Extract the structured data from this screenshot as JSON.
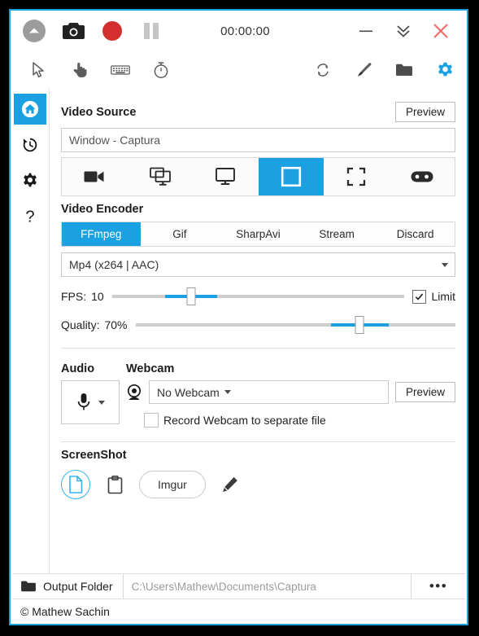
{
  "window": {
    "border_color": "#1ba1e2",
    "accent_color": "#1ba1e2"
  },
  "titlebar": {
    "timer": "00:00:00",
    "buttons": [
      {
        "name": "expand-collapse-button",
        "icon": "chevron-up-circle-icon"
      },
      {
        "name": "screenshot-button",
        "icon": "camera-icon"
      },
      {
        "name": "record-button",
        "icon": "record-circle-icon"
      },
      {
        "name": "pause-button",
        "icon": "pause-icon"
      }
    ],
    "window_buttons": [
      {
        "name": "minimize-button",
        "icon": "minimize-icon"
      },
      {
        "name": "collapse-button",
        "icon": "double-chevron-down-icon"
      },
      {
        "name": "close-button",
        "icon": "close-icon"
      }
    ]
  },
  "toolbar": {
    "left": [
      {
        "name": "cursor-toggle",
        "icon": "cursor-arrow-icon"
      },
      {
        "name": "click-highlight-toggle",
        "icon": "pointing-hand-icon"
      },
      {
        "name": "keystrokes-toggle",
        "icon": "keyboard-icon"
      },
      {
        "name": "timer-toggle",
        "icon": "stopwatch-icon"
      }
    ],
    "right": [
      {
        "name": "refresh-button",
        "icon": "refresh-icon"
      },
      {
        "name": "theme-brush-button",
        "icon": "paintbrush-icon"
      },
      {
        "name": "open-folder-button",
        "icon": "folder-icon"
      },
      {
        "name": "settings-button",
        "icon": "gear-icon"
      }
    ]
  },
  "sidebar": {
    "items": [
      {
        "name": "sidebar-item-home",
        "icon": "home-icon",
        "active": true
      },
      {
        "name": "sidebar-item-recent",
        "icon": "history-clock-icon",
        "active": false
      },
      {
        "name": "sidebar-item-configure",
        "icon": "gear-icon",
        "active": false
      },
      {
        "name": "sidebar-item-about",
        "icon": "question-mark-icon",
        "active": false
      }
    ]
  },
  "video_source": {
    "title": "Video Source",
    "preview_label": "Preview",
    "selected": "Window  -  Captura",
    "modes": [
      {
        "name": "source-mode-no-video",
        "icon": "video-camera-icon",
        "active": false
      },
      {
        "name": "source-mode-desk-duplication",
        "icon": "multi-screen-icon",
        "active": false
      },
      {
        "name": "source-mode-screen",
        "icon": "monitor-icon",
        "active": false
      },
      {
        "name": "source-mode-window",
        "icon": "window-icon",
        "active": true
      },
      {
        "name": "source-mode-region",
        "icon": "crop-region-icon",
        "active": false
      },
      {
        "name": "source-mode-game",
        "icon": "gamepad-icon",
        "active": false
      }
    ]
  },
  "video_encoder": {
    "title": "Video Encoder",
    "tabs": [
      {
        "label": "FFmpeg",
        "active": true
      },
      {
        "label": "Gif",
        "active": false
      },
      {
        "label": "SharpAvi",
        "active": false
      },
      {
        "label": "Stream",
        "active": false
      },
      {
        "label": "Discard",
        "active": false
      }
    ],
    "format": "Mp4 (x264 | AAC)",
    "fps": {
      "label": "FPS:",
      "value": "10",
      "percent": 27,
      "limit_label": "Limit",
      "limit_checked": true
    },
    "quality": {
      "label": "Quality:",
      "value": "70%",
      "percent": 70
    }
  },
  "audio": {
    "title": "Audio",
    "device_icon": "microphone-icon"
  },
  "webcam": {
    "title": "Webcam",
    "icon": "webcam-icon",
    "selected": "No Webcam",
    "preview_label": "Preview",
    "separate_file_label": "Record Webcam to separate file",
    "separate_file_checked": false
  },
  "screenshot": {
    "title": "ScreenShot",
    "targets": [
      {
        "name": "screenshot-to-disk-button",
        "icon": "file-document-icon",
        "active": true
      },
      {
        "name": "screenshot-to-clipboard-button",
        "icon": "clipboard-icon",
        "active": false
      }
    ],
    "imgur_label": "Imgur",
    "edit_icon": "pencil-icon"
  },
  "output": {
    "folder_icon": "folder-icon",
    "label": "Output Folder",
    "path": "C:\\Users\\Mathew\\Documents\\Captura",
    "more_label": "•••"
  },
  "statusbar": {
    "text": "© Mathew Sachin"
  }
}
